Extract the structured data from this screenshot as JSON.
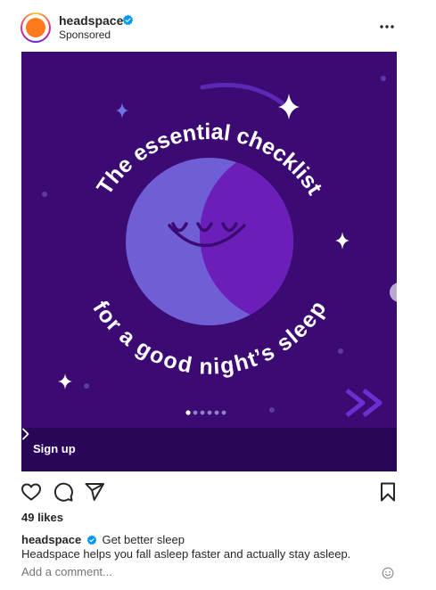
{
  "post": {
    "account_name": "headspace",
    "sponsored_label": "Sponsored",
    "colors": {
      "avatar": "#ff7a1a",
      "ad_bg": "#3b0a73",
      "moon": "#6f5ed6",
      "moon_shadow": "#6b1fb8",
      "cta_bar": "#2a0658",
      "verified": "#0095f6"
    }
  },
  "ad": {
    "title_top": "The essential checklist",
    "title_bottom": "for a good night’s sleep",
    "cta_label": "Sign up",
    "carousel": {
      "slides": 6,
      "active": 1
    }
  },
  "actions": {
    "likes": "49 likes"
  },
  "caption": {
    "user": "headspace",
    "headline": "Get better sleep",
    "text": "Headspace helps you fall asleep faster and actually stay asleep."
  },
  "comment": {
    "placeholder": "Add a comment..."
  }
}
